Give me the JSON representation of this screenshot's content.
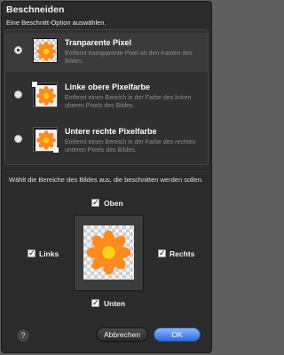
{
  "dialog": {
    "title": "Beschneiden",
    "subtitle": "Eine Beschnitt-Option auswählen."
  },
  "options": [
    {
      "title": "Tranparente Pixel",
      "description": "Entfernt transparente Pixel an den Kanten des Bildes.",
      "selected": true
    },
    {
      "title": "Linke obere Pixelfarbe",
      "description": "Entfernt einen Bereich in der Farbe des linken oberen Pixels des Bildes.",
      "selected": false
    },
    {
      "title": "Untere rechte Pixelfarbe",
      "description": "Entfernt einen Bereich in der Farbe des rechten unteren Pixels des Bildes.",
      "selected": false
    }
  ],
  "crop_sides": {
    "description": "Wählt die Bereiche des Bildes aus, die beschnitten werden sollen.",
    "top": {
      "label": "Oben",
      "checked": true
    },
    "left": {
      "label": "Links",
      "checked": true
    },
    "right": {
      "label": "Rechts",
      "checked": true
    },
    "bottom": {
      "label": "Unten",
      "checked": true
    }
  },
  "footer": {
    "help_label": "?",
    "cancel_label": "Abbrechen",
    "ok_label": "OK"
  },
  "colors": {
    "dialog_bg": "#2b2b2b",
    "flower_petal": "#ff8a1e",
    "flower_center": "#ffd21f",
    "ok_button": "#2d6cdf"
  },
  "icons": {
    "check": "✓"
  }
}
